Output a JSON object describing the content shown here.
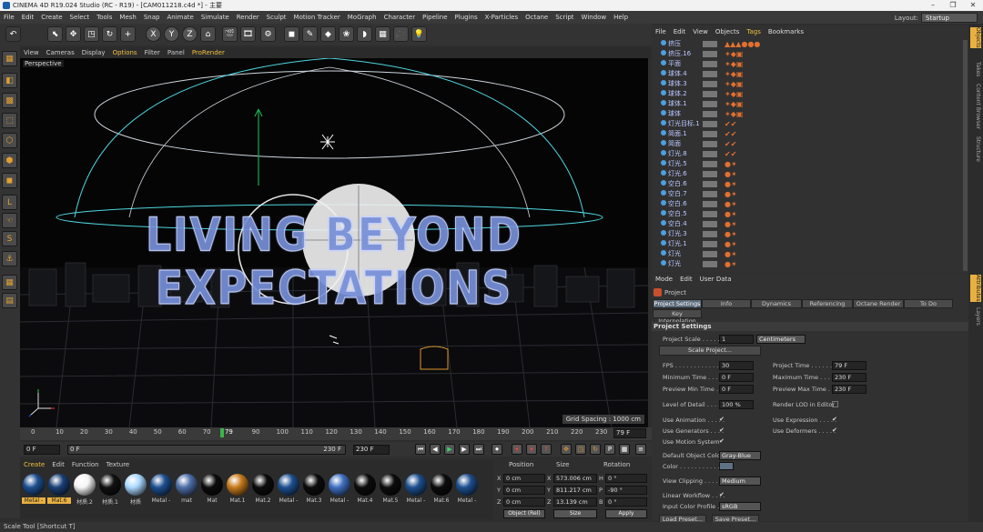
{
  "titlebar": {
    "title": "CINEMA 4D R19.024 Studio (RC - R19) - [CAM011218.c4d *] - 主要",
    "min": "–",
    "max": "❐",
    "close": "✕"
  },
  "menubar": {
    "items": [
      "File",
      "Edit",
      "Create",
      "Select",
      "Tools",
      "Mesh",
      "Snap",
      "Animate",
      "Simulate",
      "Render",
      "Sculpt",
      "Motion Tracker",
      "MoGraph",
      "Character",
      "Pipeline",
      "Plugins",
      "X-Particles",
      "Octane",
      "Script",
      "Window",
      "Help"
    ],
    "layout_label": "Layout:",
    "layout_value": "Startup"
  },
  "toolbar": {
    "icons": [
      "undo-icon",
      "live-select-icon",
      "move-icon",
      "scale-icon",
      "rotate-icon",
      "add-icon",
      "x-axis-icon",
      "y-axis-icon",
      "z-axis-icon",
      "coord-system-icon",
      "render-view-icon",
      "render-picture-icon",
      "render-settings-icon",
      "cube-icon",
      "pen-icon",
      "subdivide-icon",
      "array-icon",
      "deformer-icon",
      "floor-icon",
      "camera-icon",
      "light-icon"
    ],
    "glyphs": [
      "↶",
      "⬉",
      "✥",
      "◳",
      "↻",
      "+",
      "X",
      "Y",
      "Z",
      "⌂",
      "🎬",
      "🎞",
      "⚙",
      "◼",
      "✎",
      "◆",
      "❀",
      "◗",
      "▦",
      "🎥",
      "💡"
    ]
  },
  "viewport": {
    "menu": [
      "View",
      "Cameras",
      "Display",
      "Options",
      "Filter",
      "Panel",
      "ProRender"
    ],
    "label": "Perspective",
    "grid_spacing": "Grid Spacing : 1000 cm",
    "headline": "LIVING BEYOND EXPECTATIONS"
  },
  "timeline": {
    "ticks": [
      "0",
      "10",
      "20",
      "30",
      "40",
      "50",
      "60",
      "70",
      "79",
      "90",
      "100",
      "110",
      "120",
      "130",
      "140",
      "150",
      "160",
      "170",
      "180",
      "190",
      "200",
      "210",
      "220",
      "230"
    ],
    "current": "79 F",
    "current_frame": 79,
    "max_frame": 230
  },
  "transport": {
    "start": "0 F",
    "scrub": "0 F",
    "end_a": "230 F",
    "end_b": "230 F"
  },
  "materials": {
    "menu": [
      "Create",
      "Edit",
      "Function",
      "Texture"
    ],
    "items": [
      {
        "label": "Metal -",
        "color": "#1d4f8f",
        "selected": true
      },
      {
        "label": "Mat.6",
        "color": "#1a3f77",
        "selected": true
      },
      {
        "label": "材质.2",
        "color": "#f4f4f4",
        "selected": false
      },
      {
        "label": "材质.1",
        "color": "#111111",
        "selected": false
      },
      {
        "label": "材质",
        "color": "#a9d8ff",
        "selected": false
      },
      {
        "label": "Metal -",
        "color": "#1d4f8f",
        "selected": false
      },
      {
        "label": "mat",
        "color": "#4d6ea8",
        "selected": false
      },
      {
        "label": "Mat",
        "color": "#0c0c0c",
        "selected": false
      },
      {
        "label": "Mat.1",
        "color": "#c77a1c",
        "selected": false
      },
      {
        "label": "Mat.2",
        "color": "#0c0c0c",
        "selected": false
      },
      {
        "label": "Metal -",
        "color": "#1d4f8f",
        "selected": false
      },
      {
        "label": "Mat.3",
        "color": "#0c0c0c",
        "selected": false
      },
      {
        "label": "Metal -",
        "color": "#3f6fc0",
        "selected": false
      },
      {
        "label": "Mat.4",
        "color": "#0c0c0c",
        "selected": false
      },
      {
        "label": "Mat.5",
        "color": "#0c0c0c",
        "selected": false
      },
      {
        "label": "Metal -",
        "color": "#1d4f8f",
        "selected": false
      },
      {
        "label": "Mat.6",
        "color": "#0c0c0c",
        "selected": false
      },
      {
        "label": "Metal -",
        "color": "#1d4f8f",
        "selected": false
      }
    ]
  },
  "coords": {
    "headers": [
      "Position",
      "Size",
      "Rotation"
    ],
    "rows": [
      {
        "axis": "X",
        "pos": "0 cm",
        "size_axis": "X",
        "size": "573.006 cm",
        "rot_axis": "H",
        "rot": "0 °"
      },
      {
        "axis": "Y",
        "pos": "0 cm",
        "size_axis": "Y",
        "size": "811.217 cm",
        "rot_axis": "P",
        "rot": "-90 °"
      },
      {
        "axis": "Z",
        "pos": "0 cm",
        "size_axis": "Z",
        "size": "13.139 cm",
        "rot_axis": "B",
        "rot": "0 °"
      }
    ],
    "mode": "Object (Rel)",
    "size_mode": "Size",
    "apply": "Apply"
  },
  "objects": {
    "menu": [
      "File",
      "Edit",
      "View",
      "Objects",
      "Tags",
      "Bookmarks"
    ],
    "rows": [
      "挤压",
      "挤压.16",
      "平面",
      "球体.4",
      "球体.3",
      "球体.2",
      "球体.1",
      "球体",
      "灯光目标.1",
      "简面.1",
      "简面",
      "灯光.8",
      "灯光.5",
      "灯光.6",
      "空白.6",
      "空白.7",
      "空白.6",
      "空白.5",
      "空白.4",
      "灯光.3",
      "灯光.1",
      "灯光",
      "灯光"
    ]
  },
  "attributes": {
    "menu": [
      "Mode",
      "Edit",
      "User Data"
    ],
    "object_name": "Project",
    "tabs": [
      "Project Settings",
      "Info",
      "Dynamics",
      "Referencing",
      "Octane Render",
      "To Do"
    ],
    "tab2": "Key Interpolation",
    "section": "Project Settings",
    "project_scale_label": "Project Scale . . . . . .",
    "project_scale": "1",
    "project_unit": "Centimeters",
    "scale_project": "Scale Project...",
    "fps_label": "FPS . . . . . . . . . . . . .",
    "fps": "30",
    "ptime_label": "Project Time . . . . . .",
    "ptime": "79 F",
    "mintime_label": "Minimum Time . . . . .",
    "mintime": "0 F",
    "maxtime_label": "Maximum Time . . . .",
    "maxtime": "230 F",
    "pmin_label": "Preview Min Time . .",
    "pmin": "0 F",
    "pmax_label": "Preview Max Time . .",
    "pmax": "230 F",
    "lod_label": "Level of Detail . . . .",
    "lod": "100 %",
    "render_lod": "Render LOD in Editor",
    "use_anim": "Use Animation . . . . .",
    "use_expr": "Use Expression . . . . .",
    "use_gen": "Use Generators . . . .",
    "use_def": "Use Deformers . . . . .",
    "use_motion": "Use Motion System",
    "def_color_label": "Default Object Color",
    "def_color": "Gray-Blue",
    "color_label": "Color . . . . . . . . . . .",
    "clipping_label": "View Clipping . . . . . .",
    "clipping": "Medium",
    "linear_label": "Linear Workflow . . . .",
    "icp_label": "Input Color Profile . .",
    "icp": "sRGB",
    "load_preset": "Load Preset...",
    "save_preset": "Save Preset..."
  },
  "rightstrip": {
    "tabs": [
      "Objects",
      "Takes",
      "Content Browser",
      "Structure",
      "Attributes",
      "Layers"
    ]
  },
  "status": "Scale Tool [Shortcut T]"
}
